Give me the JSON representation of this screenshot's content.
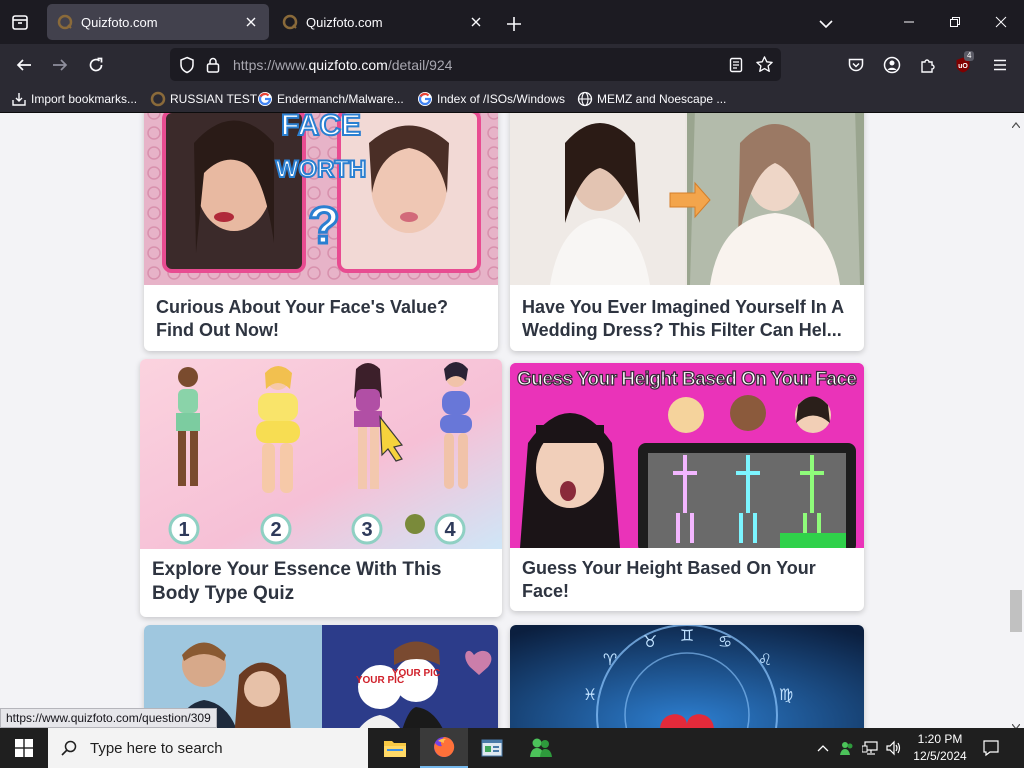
{
  "browser": {
    "tabs": [
      {
        "title": "Quizfoto.com",
        "active": true
      },
      {
        "title": "Quizfoto.com",
        "active": false
      }
    ],
    "url": {
      "scheme_host_dim": "https://www.",
      "host": "quizfoto.com",
      "path": "/detail/924"
    },
    "extension_badge": "4",
    "bookmarks": [
      {
        "label": "Import bookmarks...",
        "icon": "import-icon"
      },
      {
        "label": "RUSSIAN TEST",
        "icon": "quizfoto-favicon"
      },
      {
        "label": "Endermanch/Malware...",
        "icon": "google-favicon"
      },
      {
        "label": "Index of /ISOs/Windows",
        "icon": "google-favicon"
      },
      {
        "label": "MEMZ and Noescape ...",
        "icon": "globe-icon"
      }
    ]
  },
  "page": {
    "cards": [
      {
        "caption": "Curious About Your Face's Value? Find Out Now!",
        "image": "face-worth-thumbnail"
      },
      {
        "caption": "Have You Ever Imagined Yourself In A Wedding Dress? This Filter Can Hel...",
        "image": "wedding-dress-thumbnail"
      },
      {
        "caption": "Explore Your Essence With This Body Type Quiz",
        "image": "body-type-thumbnail",
        "numbers": [
          "1",
          "2",
          "3",
          "4"
        ]
      },
      {
        "caption": "Guess Your Height Based On Your Face!",
        "image": "height-thumbnail",
        "banner": "Guess Your Height Based On Your Face"
      },
      {
        "caption": "",
        "image": "couple-thumbnail",
        "labels": [
          "YOUR PIC",
          "YOUR PIC"
        ]
      },
      {
        "caption": "",
        "image": "zodiac-thumbnail"
      }
    ],
    "thumbnail_texts": {
      "face_worth_line1": "FACE",
      "face_worth_line2": "WORTH"
    },
    "status_url": "https://www.quizfoto.com/question/309"
  },
  "taskbar": {
    "search_placeholder": "Type here to search",
    "time": "1:20 PM",
    "date": "12/5/2024"
  },
  "colors": {
    "chrome_dark": "#1c1b22",
    "chrome_toolbar": "#2b2a33",
    "page_bg": "#f3f3f6",
    "caption_text": "#2e3440",
    "taskbar_bg": "#1f1f1f"
  }
}
